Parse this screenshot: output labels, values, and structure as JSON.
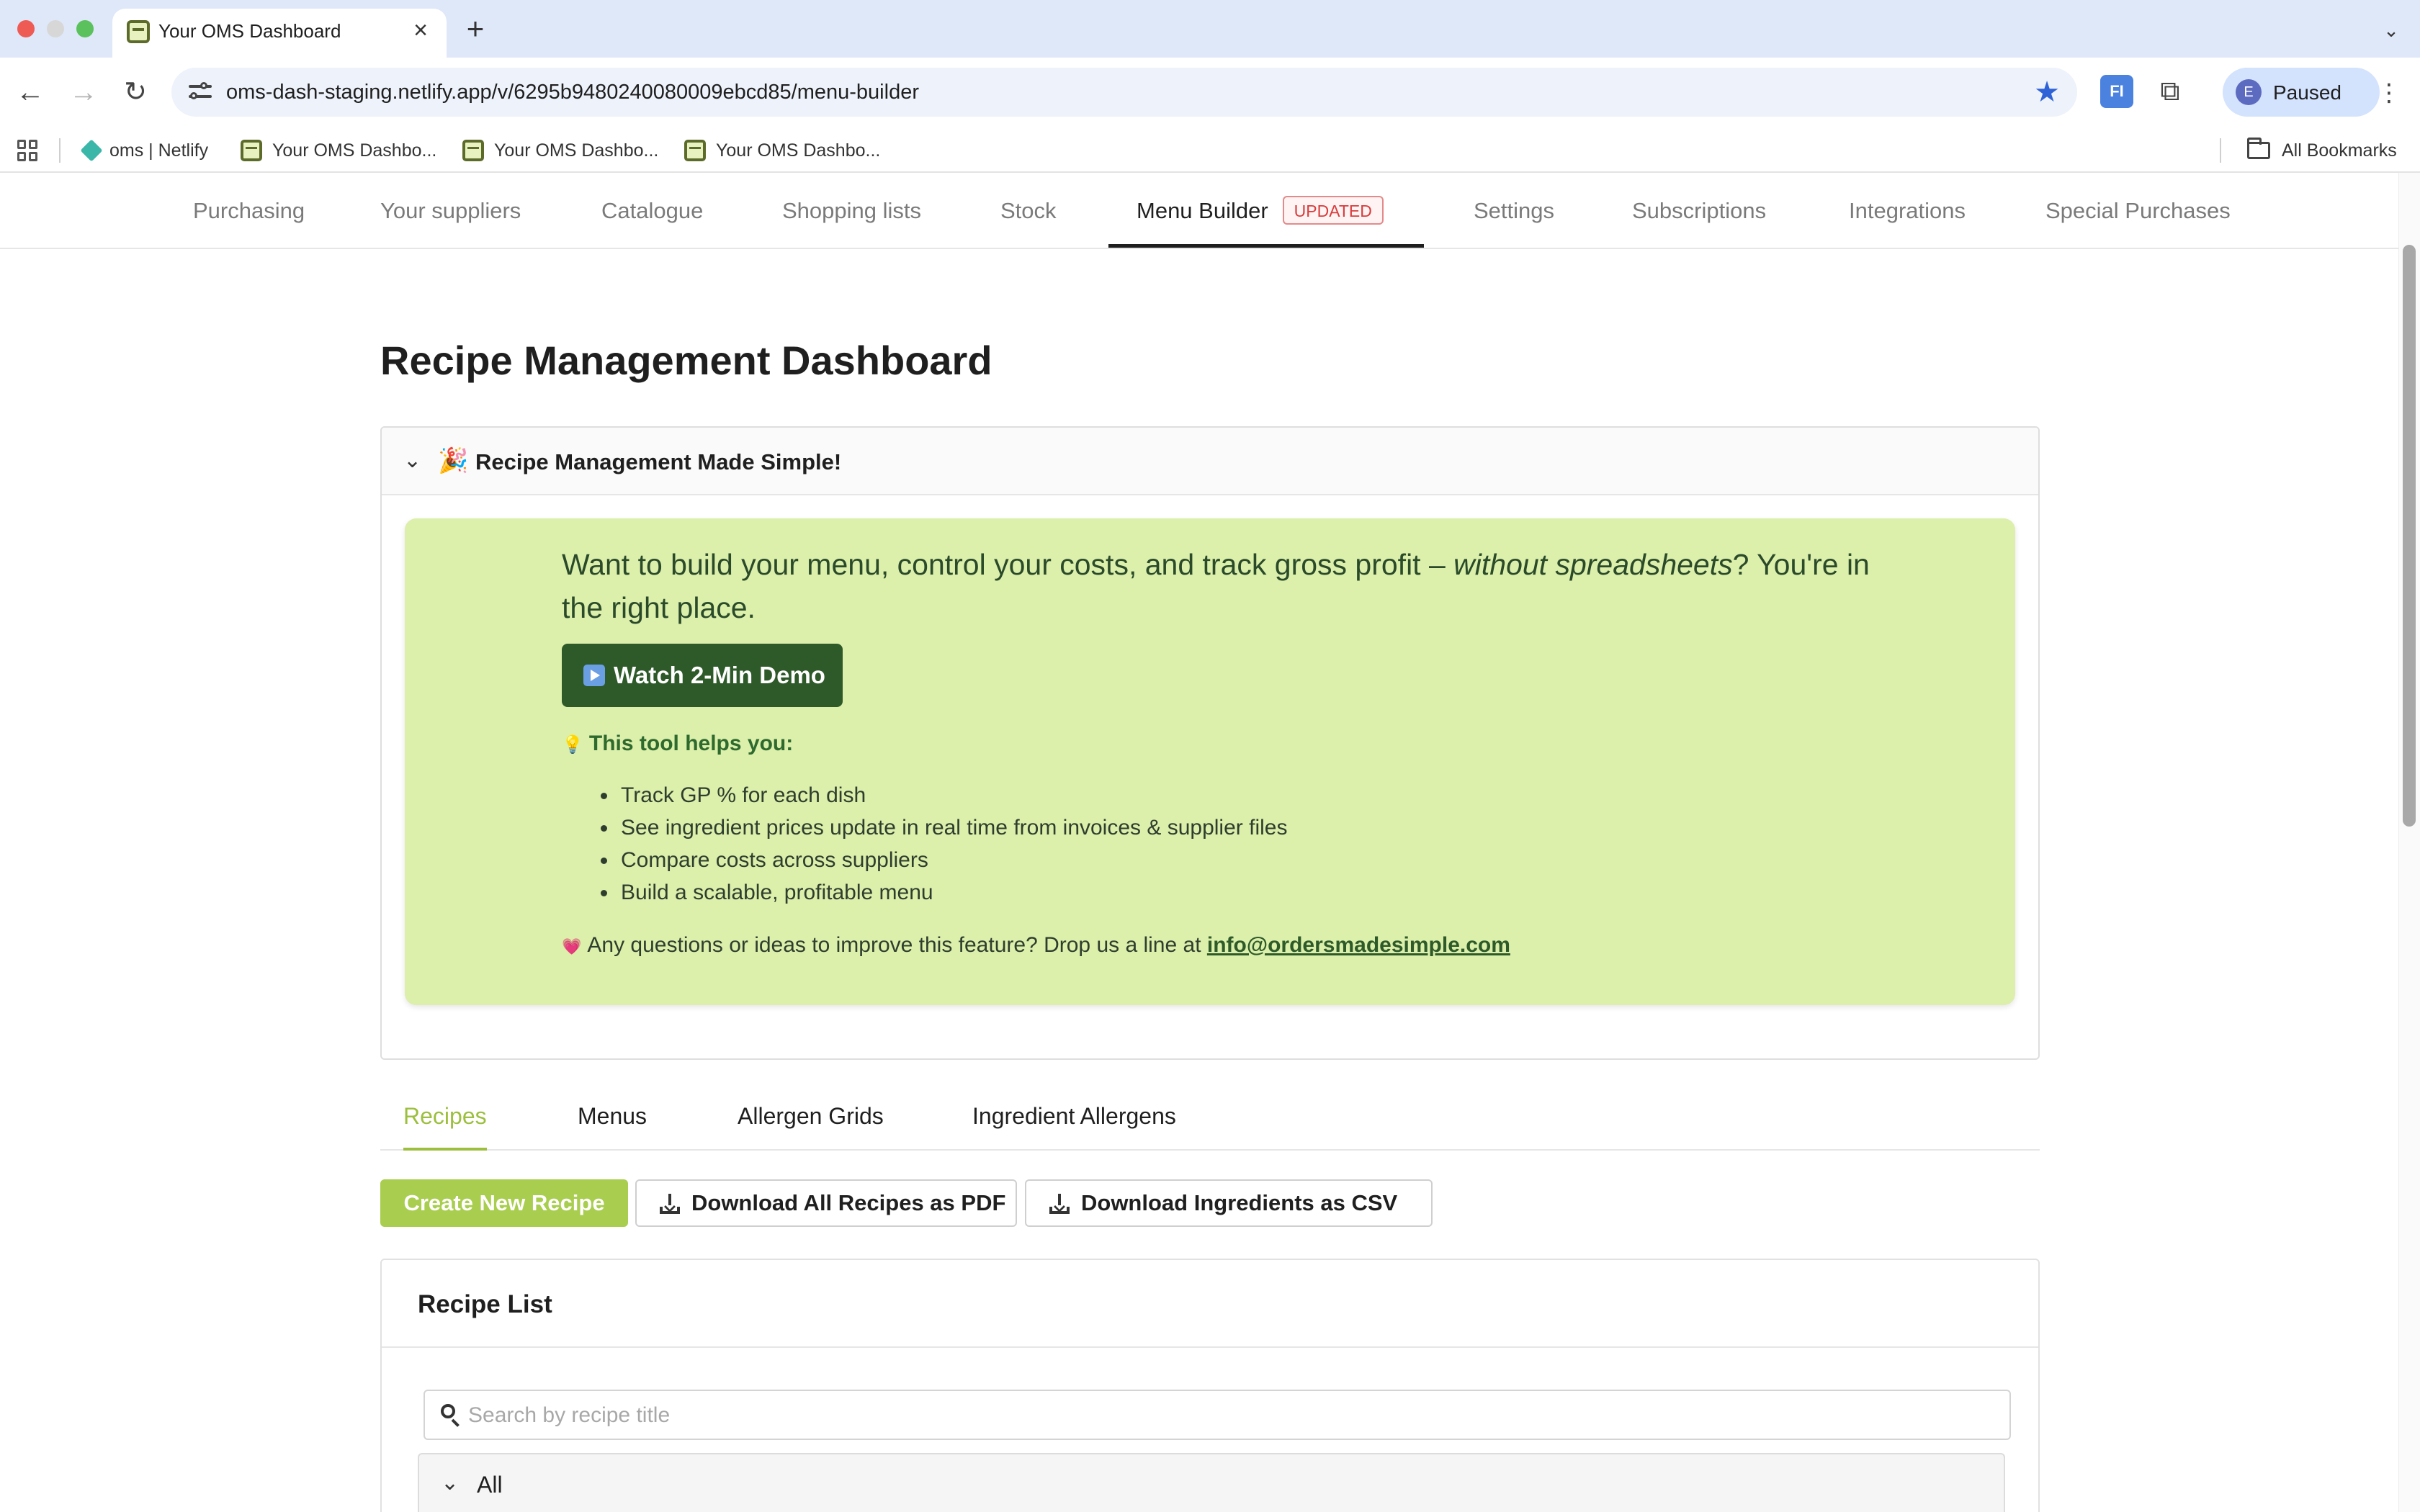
{
  "browser": {
    "tab_title": "Your OMS Dashboard",
    "url": "oms-dash-staging.netlify.app/v/6295b9480240080009ebcd85/menu-builder",
    "profile_initial": "E",
    "profile_label": "Paused",
    "extension_label": "FI",
    "bookmarks": [
      {
        "label": "oms | Netlify"
      },
      {
        "label": "Your OMS Dashbo..."
      },
      {
        "label": "Your OMS Dashbo..."
      },
      {
        "label": "Your OMS Dashbo..."
      }
    ],
    "all_bookmarks_label": "All Bookmarks"
  },
  "topnav": {
    "items": [
      {
        "label": "Purchasing"
      },
      {
        "label": "Your suppliers"
      },
      {
        "label": "Catalogue"
      },
      {
        "label": "Shopping lists"
      },
      {
        "label": "Stock"
      },
      {
        "label": "Menu Builder",
        "badge": "UPDATED",
        "active": true
      },
      {
        "label": "Settings"
      },
      {
        "label": "Subscriptions"
      },
      {
        "label": "Integrations"
      },
      {
        "label": "Special Purchases"
      }
    ]
  },
  "page": {
    "title": "Recipe Management Dashboard"
  },
  "intro": {
    "header_title": "Recipe Management Made Simple!",
    "lead_before": "Want to build your menu, control your costs, and track gross profit – ",
    "lead_emphasis": "without spreadsheets",
    "lead_after": "? You're in the right place.",
    "demo_button": "Watch 2-Min Demo",
    "helps_heading": "This tool helps you:",
    "bullets": [
      "Track GP % for each dish",
      "See ingredient prices update in real time from invoices & supplier files",
      "Compare costs across suppliers",
      "Build a scalable, profitable menu"
    ],
    "contact_text": "Any questions or ideas to improve this feature? Drop us a line at ",
    "contact_email": "info@ordersmadesimple.com"
  },
  "tabs": [
    {
      "label": "Recipes",
      "active": true
    },
    {
      "label": "Menus"
    },
    {
      "label": "Allergen Grids"
    },
    {
      "label": "Ingredient Allergens"
    }
  ],
  "actions": {
    "create": "Create New Recipe",
    "download_pdf": "Download All Recipes as PDF",
    "download_csv": "Download Ingredients as CSV"
  },
  "recipe_list": {
    "title": "Recipe List",
    "search_placeholder": "Search by recipe title",
    "group_label": "All"
  },
  "colors": {
    "accent_green": "#a9cd4e",
    "dark_green": "#2e5a2a",
    "banner_green": "#dcefab",
    "badge_red": "#d93c3c"
  }
}
